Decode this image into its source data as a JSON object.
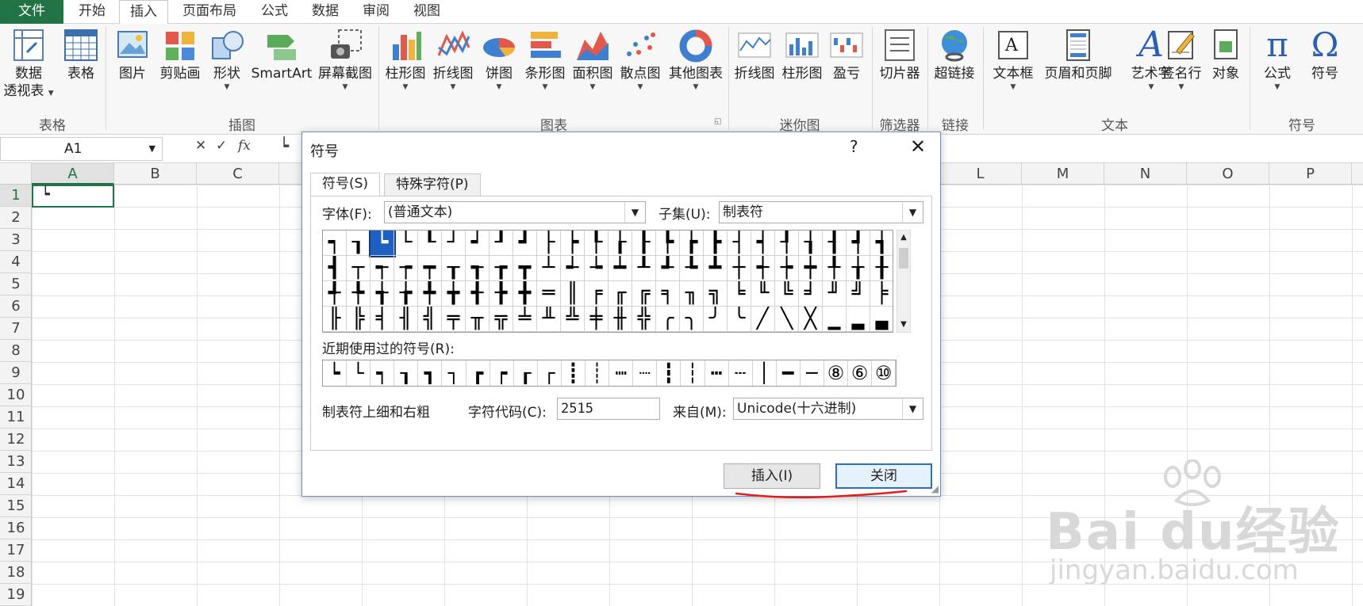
{
  "menu": {
    "file": "文件",
    "tabs": [
      "开始",
      "插入",
      "页面布局",
      "公式",
      "数据",
      "审阅",
      "视图"
    ],
    "active_tab": "插入"
  },
  "ribbon": {
    "groups": {
      "table": "表格",
      "illustrations": "插图",
      "charts": "图表",
      "sparklines": "迷你图",
      "filter": "筛选器",
      "links": "链接",
      "text": "文本",
      "symbols": "符号"
    },
    "buttons": {
      "pivot_line1": "数据",
      "pivot_line2": "透视表",
      "table": "表格",
      "picture": "图片",
      "clipart": "剪贴画",
      "shapes": "形状",
      "smartart": "SmartArt",
      "screenshot": "屏幕截图",
      "column": "柱形图",
      "line": "折线图",
      "pie": "饼图",
      "bar": "条形图",
      "area": "面积图",
      "scatter": "散点图",
      "other": "其他图表",
      "spark_line": "折线图",
      "spark_column": "柱形图",
      "spark_winloss": "盈亏",
      "slicer": "切片器",
      "hyperlink": "超链接",
      "textbox": "文本框",
      "header_footer": "页眉和页脚",
      "wordart": "艺术字",
      "signature": "签名行",
      "object": "对象",
      "equation": "公式",
      "symbol": "符号"
    },
    "glyphs": {
      "equation": "π",
      "symbol": "Ω",
      "wordart": "A"
    }
  },
  "formula_bar": {
    "name_box": "A1",
    "cancel": "✕",
    "enter": "✓",
    "fx": "fx",
    "content": "┕"
  },
  "grid": {
    "columns_left": [
      "A",
      "B",
      "C"
    ],
    "columns_right": [
      "L",
      "M",
      "N",
      "O",
      "P"
    ],
    "rows": [
      "1",
      "2",
      "3",
      "4",
      "5",
      "6",
      "7",
      "8",
      "9",
      "10",
      "11",
      "12",
      "13",
      "14",
      "15",
      "16",
      "17",
      "18",
      "19"
    ],
    "a1_value": "┕"
  },
  "dialog": {
    "title": "符号",
    "help": "?",
    "close": "✕",
    "tabs": [
      "符号(S)",
      "特殊字符(P)"
    ],
    "font_label": "字体(F):",
    "font_value": "(普通文本)",
    "subset_label": "子集(U):",
    "subset_value": "制表符",
    "symbols": [
      "┑",
      "┒",
      "┕",
      "└",
      "┖",
      "┘",
      "┙",
      "┚",
      "┛",
      "├",
      "┝",
      "┞",
      "┟",
      "┠",
      "┡",
      "┢",
      "┣",
      "┤",
      "┥",
      "┦",
      "┧",
      "┨",
      "┩",
      "┪",
      "┫",
      "┬",
      "┭",
      "┮",
      "┯",
      "┰",
      "┱",
      "┲",
      "┳",
      "┴",
      "┵",
      "┶",
      "┷",
      "┸",
      "┹",
      "┺",
      "┻",
      "┼",
      "┽",
      "┾",
      "┿",
      "╀",
      "╁",
      "╂",
      "╃",
      "╄",
      "╅",
      "╆",
      "╇",
      "╈",
      "╉",
      "╊",
      "╋",
      "═",
      "║",
      "╒",
      "╓",
      "╔",
      "╕",
      "╖",
      "╗",
      "╘",
      "╙",
      "╚",
      "╛",
      "╜",
      "╝",
      "╞",
      "╟",
      "╠",
      "╡",
      "╢",
      "╣",
      "╤",
      "╥",
      "╦",
      "╧",
      "╨",
      "╩",
      "╪",
      "╫",
      "╬",
      "╭",
      "╮",
      "╯",
      "╰",
      "╱",
      "╲",
      "╳",
      "▁",
      "▂",
      "▃"
    ],
    "selected_index": 2,
    "recent_label": "近期使用过的符号(R):",
    "recent": [
      "┕",
      "└",
      "┑",
      "┒",
      "┓",
      "┐",
      "┏",
      "┍",
      "┎",
      "┌",
      "┋",
      "┊",
      "┉",
      "┈",
      "┇",
      "┆",
      "┅",
      "┄",
      "│",
      "━",
      "─",
      "⑧",
      "⑥",
      "⑩"
    ],
    "char_name": "制表符上细和右粗",
    "code_label": "字符代码(C):",
    "code_value": "2515",
    "from_label": "来自(M):",
    "from_value": "Unicode(十六进制)",
    "insert": "插入(I)",
    "close_button": "关闭"
  },
  "watermark": {
    "brand": "Bai du经验",
    "url": "jingyan.baidu.com"
  },
  "colors": {
    "excel_green": "#217346",
    "selection_blue": "#1f5fbf",
    "annotation_red": "#e02020"
  }
}
